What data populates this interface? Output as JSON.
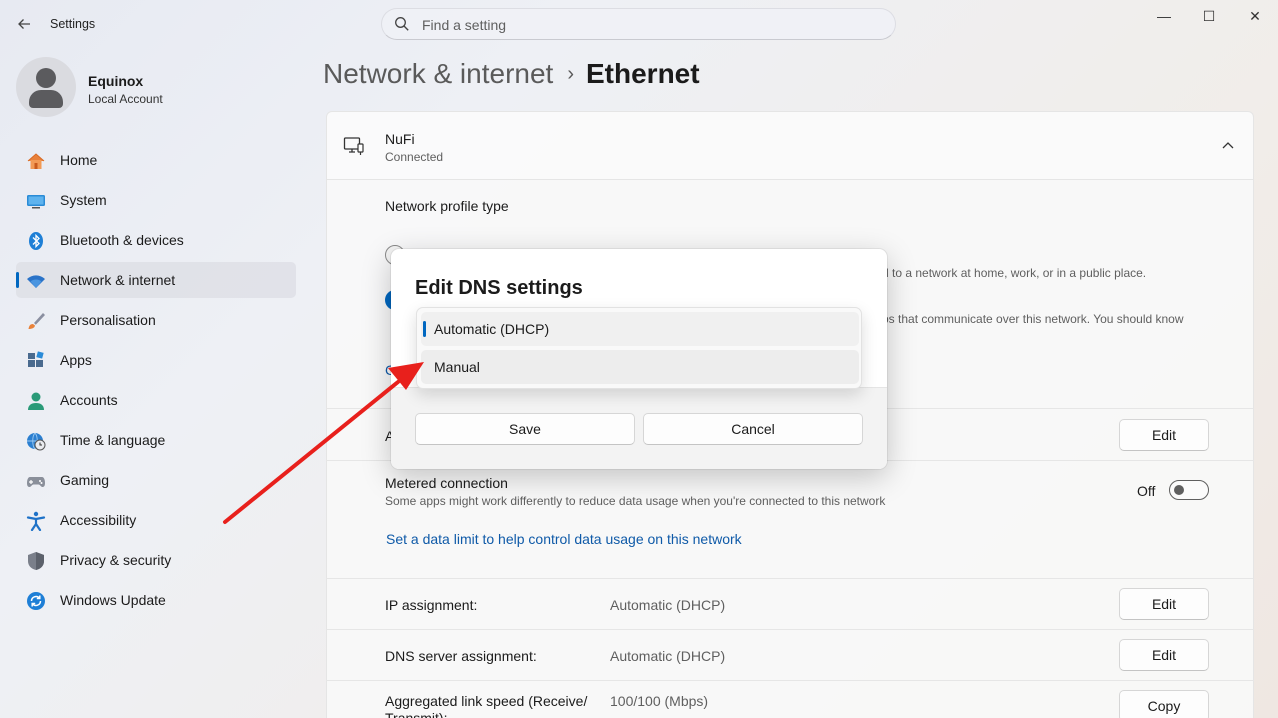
{
  "window": {
    "title": "Settings",
    "minimize": "—",
    "maximize": "☐",
    "close": "✕"
  },
  "search": {
    "placeholder": "Find a setting"
  },
  "profile": {
    "name": "Equinox",
    "account_type": "Local Account"
  },
  "sidebar": {
    "items": [
      {
        "label": "Home",
        "icon": "home-icon"
      },
      {
        "label": "System",
        "icon": "system-icon"
      },
      {
        "label": "Bluetooth & devices",
        "icon": "bluetooth-icon"
      },
      {
        "label": "Network & internet",
        "icon": "wifi-icon",
        "active": true
      },
      {
        "label": "Personalisation",
        "icon": "brush-icon"
      },
      {
        "label": "Apps",
        "icon": "apps-icon"
      },
      {
        "label": "Accounts",
        "icon": "accounts-icon"
      },
      {
        "label": "Time & language",
        "icon": "time-language-icon"
      },
      {
        "label": "Gaming",
        "icon": "gaming-icon"
      },
      {
        "label": "Accessibility",
        "icon": "accessibility-icon"
      },
      {
        "label": "Privacy & security",
        "icon": "shield-icon"
      },
      {
        "label": "Windows Update",
        "icon": "update-icon"
      }
    ]
  },
  "breadcrumb": {
    "parent": "Network & internet",
    "separator": "›",
    "current": "Ethernet"
  },
  "network": {
    "name": "NuFi",
    "status": "Connected",
    "profile_type_label": "Network profile type",
    "public_desc_fragment": "d to a network at home, work, or in a public place.",
    "private_desc_fragment": "ps that communicate over this network. You should know",
    "link_fragment": "C",
    "auth_fragment": "A",
    "edit_label": "Edit",
    "metered": {
      "title": "Metered connection",
      "desc": "Some apps might work differently to reduce data usage when you're connected to this network",
      "state": "Off"
    },
    "data_limit_link": "Set a data limit to help control data usage on this network",
    "ip_assignment": {
      "label": "IP assignment:",
      "value": "Automatic (DHCP)",
      "button": "Edit"
    },
    "dns_assignment": {
      "label": "DNS server assignment:",
      "value": "Automatic (DHCP)",
      "button": "Edit"
    },
    "link_speed": {
      "label": "Aggregated link speed (Receive/",
      "label_line2": "Transmit):",
      "value": "100/100 (Mbps)",
      "button": "Copy"
    }
  },
  "dialog": {
    "title": "Edit DNS settings",
    "options": [
      "Automatic (DHCP)",
      "Manual"
    ],
    "selected": "Automatic (DHCP)",
    "save": "Save",
    "cancel": "Cancel"
  },
  "colors": {
    "accent": "#0067c0",
    "link": "#0f5aa8",
    "arrow": "#e8201c"
  }
}
